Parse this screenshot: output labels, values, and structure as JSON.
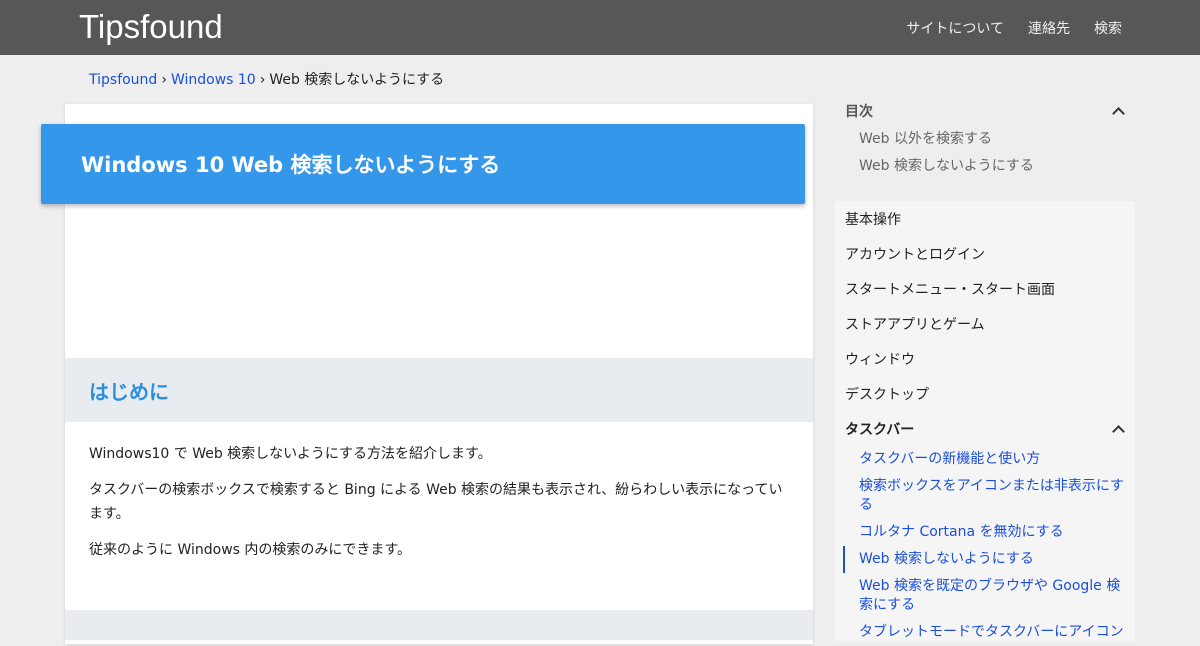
{
  "header": {
    "site_title": "Tipsfound",
    "nav": [
      "サイトについて",
      "連絡先",
      "検索"
    ]
  },
  "breadcrumb": {
    "items": [
      "Tipsfound",
      "Windows 10",
      "Web 検索しないようにする"
    ],
    "separator": "›"
  },
  "article": {
    "title": "Windows 10 Web 検索しないようにする",
    "section_heading": "はじめに",
    "paragraphs": [
      "Windows10 で Web 検索しないようにする方法を紹介します。",
      "タスクバーの検索ボックスで検索すると Bing による Web 検索の結果も表示され、紛らわしい表示になっています。",
      "従来のように Windows 内の検索のみにできます。"
    ]
  },
  "toc": {
    "heading": "目次",
    "items": [
      "Web 以外を検索する",
      "Web 検索しないようにする"
    ]
  },
  "categories": {
    "items": [
      "基本操作",
      "アカウントとログイン",
      "スタートメニュー・スタート画面",
      "ストアアプリとゲーム",
      "ウィンドウ",
      "デスクトップ"
    ],
    "active": "タスクバー",
    "sub_items": [
      "タスクバーの新機能と使い方",
      "検索ボックスをアイコンまたは非表示にする",
      "コルタナ Cortana を無効にする",
      "Web 検索しないようにする",
      "Web 検索を既定のブラウザや Google 検索にする",
      "タブレットモードでタスクバーにアイコン"
    ]
  },
  "colors": {
    "header_bg": "#575757",
    "banner_bg": "#3597ea",
    "link": "#1a4fd8",
    "section_heading": "#2b8fe0"
  }
}
